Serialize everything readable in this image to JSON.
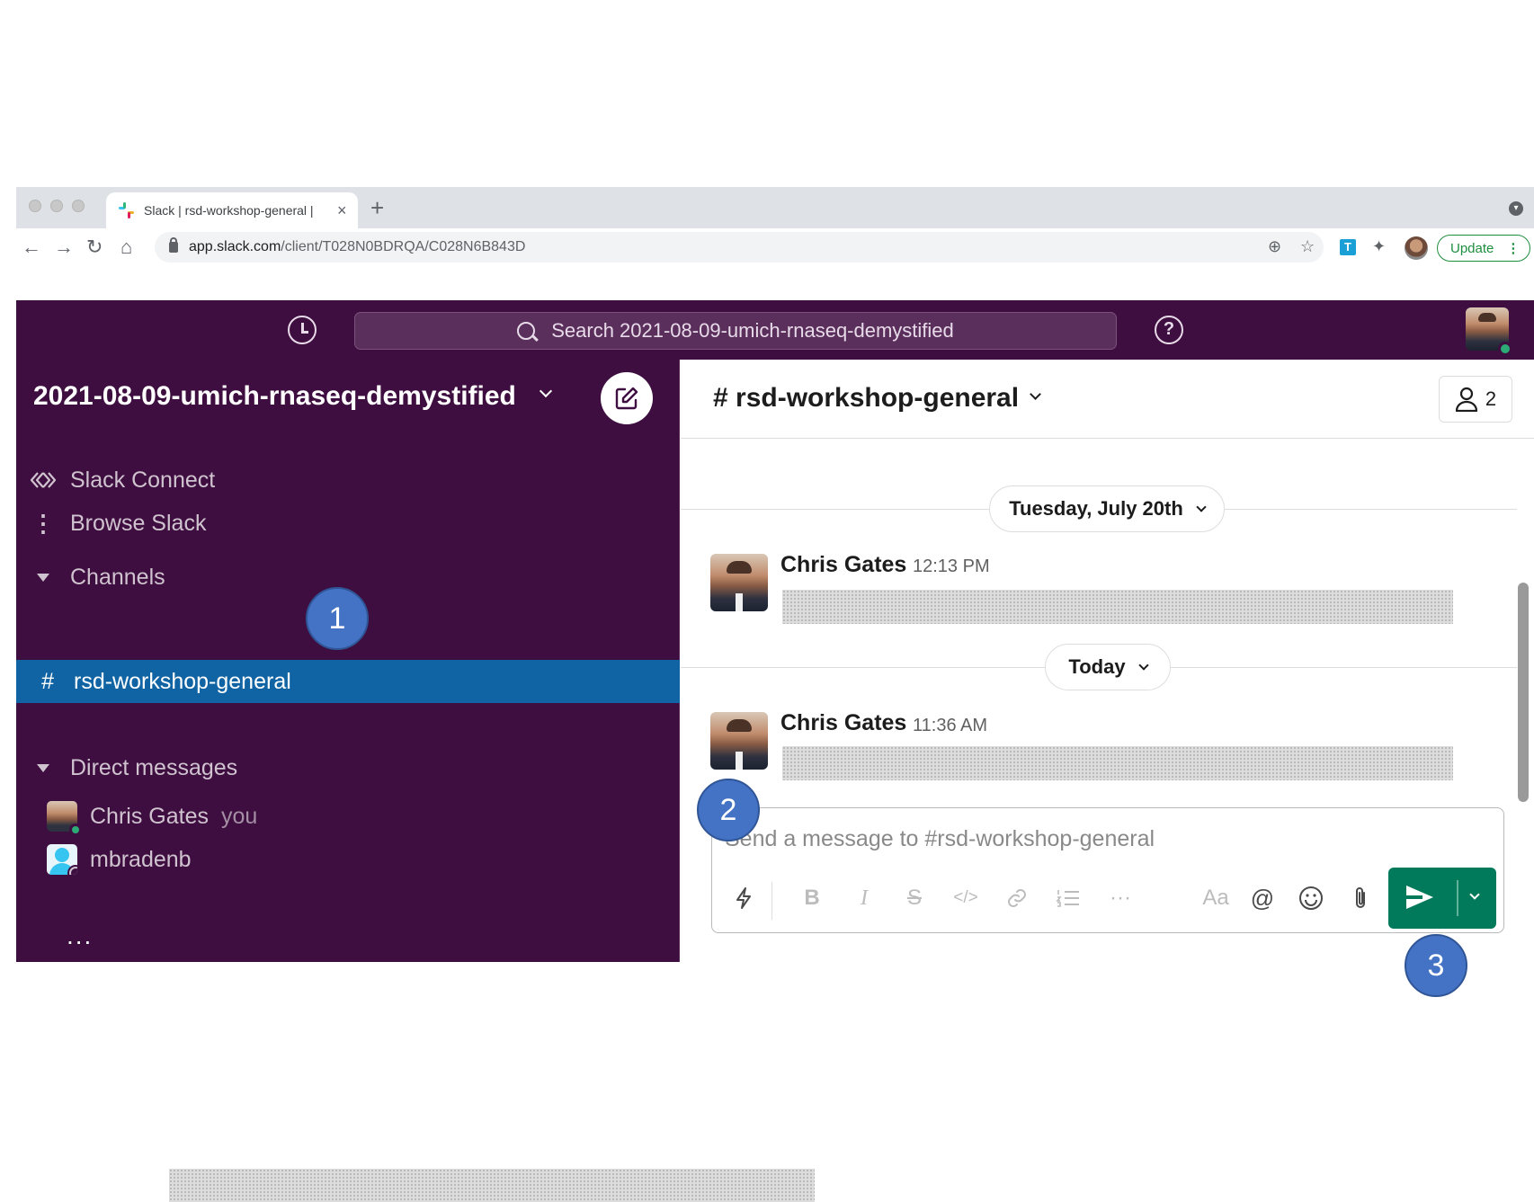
{
  "browser": {
    "tab_title": "Slack | rsd-workshop-general |",
    "tab_close": "×",
    "new_tab": "+",
    "url_host": "app.slack.com",
    "url_path": "/client/T028N0BDRQA/C028N6B843D",
    "extension_label": "T",
    "update_label": "Update",
    "update_menu": "⋮"
  },
  "slack": {
    "search_placeholder": "Search 2021-08-09-umich-rnaseq-demystified",
    "help": "?",
    "workspace_name": "2021-08-09-umich-rnaseq-demystified",
    "sidebar": {
      "slack_connect": "Slack Connect",
      "browse_slack": "Browse Slack",
      "channels_heading": "Channels",
      "channel_hash": "#",
      "active_channel": "rsd-workshop-general",
      "dm_heading": "Direct messages",
      "dms": [
        {
          "name": "Chris Gates",
          "suffix": "you"
        },
        {
          "name": "mbradenb",
          "suffix": ""
        }
      ],
      "more": "..."
    },
    "channel": {
      "title": "# rsd-workshop-general",
      "member_count": "2"
    },
    "messages": [
      {
        "divider": "Tuesday, July 20th",
        "author": "Chris Gates",
        "time": "12:13 PM"
      },
      {
        "divider": "Today",
        "author": "Chris Gates",
        "time": "11:36 AM"
      }
    ],
    "composer": {
      "placeholder": "Send a message to #rsd-workshop-general",
      "toolbar": {
        "bold": "B",
        "italic": "I",
        "strike": "S",
        "code": "</>",
        "more": "···",
        "text_style": "Aa",
        "mention": "@"
      }
    }
  },
  "callouts": [
    "1",
    "2",
    "3"
  ],
  "colors": {
    "aubergine": "#3f0e40",
    "active_channel": "#1164a3",
    "send_green": "#007a5a",
    "callout_blue": "#4472c4",
    "presence_green": "#2bac76"
  }
}
